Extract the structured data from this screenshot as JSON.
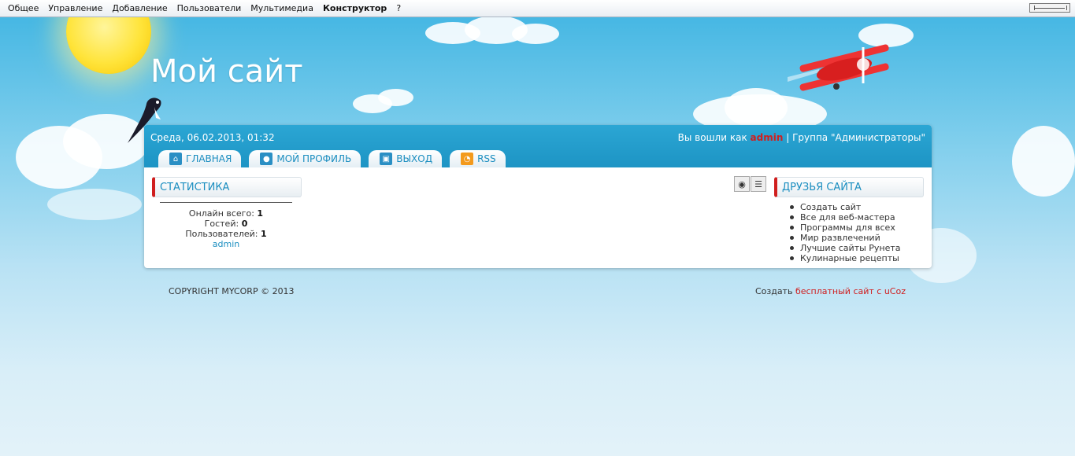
{
  "adminbar": {
    "items": [
      "Общее",
      "Управление",
      "Добавление",
      "Пользователи",
      "Мультимедиа",
      "Конструктор",
      "?"
    ]
  },
  "site": {
    "title": "Мой сайт"
  },
  "header": {
    "date": "Среда, 06.02.2013, 01:32",
    "login_prefix": "Вы вошли как",
    "username": "admin",
    "group": "| Группа \"Администраторы\""
  },
  "tabs": [
    {
      "label": "ГЛАВНАЯ",
      "icon": "home-icon"
    },
    {
      "label": "МОЙ ПРОФИЛЬ",
      "icon": "user-icon"
    },
    {
      "label": "ВЫХОД",
      "icon": "lock-icon"
    },
    {
      "label": "RSS",
      "icon": "rss-icon"
    }
  ],
  "stats": {
    "title": "СТАТИСТИКА",
    "online_label": "Онлайн всего:",
    "online_value": "1",
    "guests_label": "Гостей:",
    "guests_value": "0",
    "users_label": "Пользователей:",
    "users_value": "1",
    "user_link": "admin"
  },
  "friends": {
    "title": "ДРУЗЬЯ САЙТА",
    "items": [
      "Создать сайт",
      "Все для веб-мастера",
      "Программы для всех",
      "Мир развлечений",
      "Лучшие сайты Рунета",
      "Кулинарные рецепты"
    ]
  },
  "footer": {
    "copyright": "COPYRIGHT MYCORP © 2013",
    "create_prefix": "Создать",
    "create_link": "бесплатный сайт с uCoz"
  },
  "colors": {
    "accent": "#1b8ec0",
    "header": "#2ba6d4",
    "highlight": "#d01e1e"
  }
}
